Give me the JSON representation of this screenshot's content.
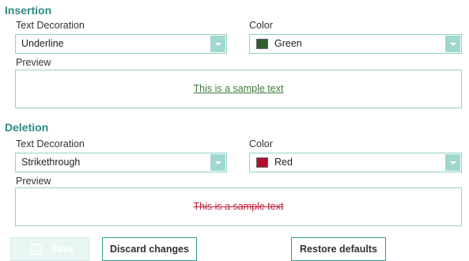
{
  "insertion": {
    "title": "Insertion",
    "text_decoration_label": "Text Decoration",
    "text_decoration_value": "Underline",
    "color_label": "Color",
    "color_value": "Green",
    "color_hex": "#2d5e2b",
    "preview_label": "Preview",
    "preview_text": "This is a sample text",
    "preview_color": "#3d7a3a"
  },
  "deletion": {
    "title": "Deletion",
    "text_decoration_label": "Text Decoration",
    "text_decoration_value": "Strikethrough",
    "color_label": "Color",
    "color_value": "Red",
    "color_hex": "#b0102c",
    "preview_label": "Preview",
    "preview_text": "This is a sample text",
    "preview_color": "#c0203a"
  },
  "buttons": {
    "save_label": "Save",
    "discard_label": "Discard changes",
    "restore_label": "Restore defaults"
  }
}
